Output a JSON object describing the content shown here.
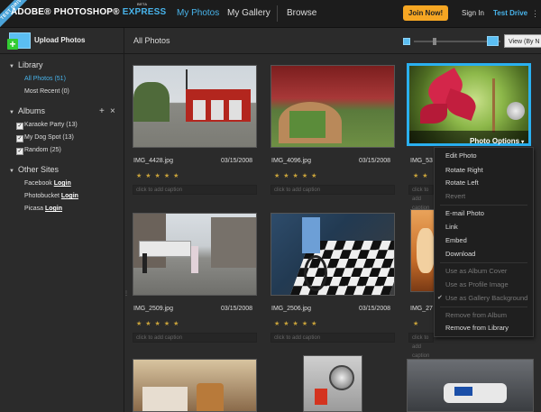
{
  "header": {
    "ribbon": "TEST DRIVE",
    "brand": "ADOBE® PHOTOSHOP®",
    "express": "EXPRESS",
    "beta": "BETA",
    "nav": [
      "My Photos",
      "My Gallery",
      "Browse"
    ],
    "join_label": "Join Now!",
    "signin_label": "Sign In",
    "testdrive_label": "Test Drive",
    "menu_icon": "⋮",
    "colors": {
      "accent": "#48b3ea",
      "join": "#f5a623"
    }
  },
  "sidebar": {
    "upload_label": "Upload Photos",
    "library_title": "Library",
    "library_items": [
      "All Photos (51)",
      "Most Recent (0)"
    ],
    "albums_title": "Albums",
    "albums": [
      "Karaoke Party (13)",
      "My Dog Spot (13)",
      "Random (25)"
    ],
    "add_icon": "+",
    "remove_icon": "×",
    "other_sites_title": "Other Sites",
    "sites": [
      {
        "name": "Facebook",
        "action": "Login"
      },
      {
        "name": "Photobucket",
        "action": "Login"
      },
      {
        "name": "Picasa",
        "action": "Login"
      }
    ]
  },
  "main": {
    "title": "All Photos",
    "view_select": "View (By N",
    "caption_placeholder": "click to add caption",
    "photos": [
      {
        "name": "IMG_4428.jpg",
        "date": "03/15/2008",
        "rating": "★★★★★"
      },
      {
        "name": "IMG_4096.jpg",
        "date": "03/15/2008",
        "rating": "★★★★★"
      },
      {
        "name": "IMG_53",
        "date": "",
        "rating": "★★"
      },
      {
        "name": "IMG_2509.jpg",
        "date": "03/15/2008",
        "rating": "★★★★★"
      },
      {
        "name": "IMG_2506.jpg",
        "date": "03/15/2008",
        "rating": "★★★★★"
      },
      {
        "name": "IMG_27",
        "date": "",
        "rating": "★"
      }
    ]
  },
  "context_menu": {
    "button_label": "Photo Options",
    "button_caret": "▾",
    "items": [
      "Edit Photo",
      "Rotate Right",
      "Rotate Left",
      "Revert",
      "E-mail Photo",
      "Link",
      "Embed",
      "Download",
      "Use as Album Cover",
      "Use as Profile Image",
      "Use as Gallery Background",
      "Remove from Album",
      "Remove from Library"
    ],
    "checkmark": "✔"
  }
}
